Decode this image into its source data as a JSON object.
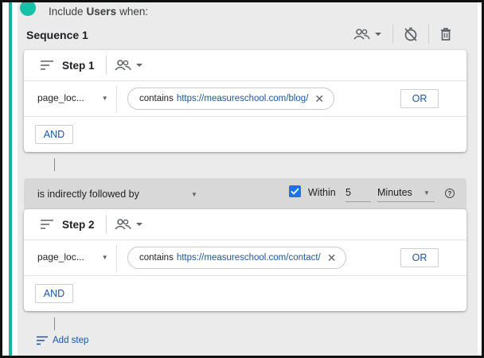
{
  "header": {
    "include_prefix": "Include",
    "include_target": "Users",
    "include_suffix": "when:",
    "sequence_title": "Sequence 1"
  },
  "steps": [
    {
      "title": "Step 1",
      "dimension": "page_loc...",
      "operator": "contains",
      "value": "https://measureschool.com/blog/",
      "or_label": "OR",
      "and_label": "AND"
    },
    {
      "title": "Step 2",
      "dimension": "page_loc...",
      "operator": "contains",
      "value": "https://measureschool.com/contact/",
      "or_label": "OR",
      "and_label": "AND"
    }
  ],
  "follow": {
    "mode": "is indirectly followed by",
    "within_checked": true,
    "within_label": "Within",
    "within_value": "5",
    "within_unit": "Minutes",
    "help_glyph": "?"
  },
  "footer": {
    "add_step_label": "Add step"
  },
  "colors": {
    "accent_teal": "#17c1a7",
    "link_blue": "#1a56a8",
    "checkbox_blue": "#1a73e8"
  }
}
